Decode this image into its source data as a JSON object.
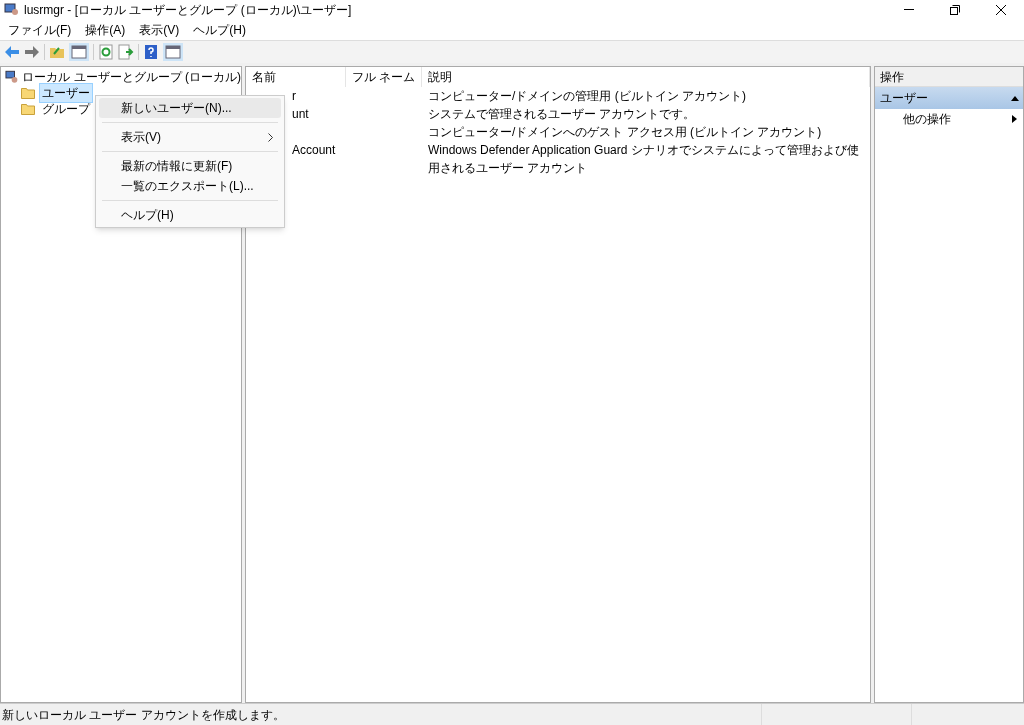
{
  "window": {
    "title": "lusrmgr - [ローカル ユーザーとグループ (ローカル)\\ユーザー]"
  },
  "menu_bar": [
    "ファイル(F)",
    "操作(A)",
    "表示(V)",
    "ヘルプ(H)"
  ],
  "tree": {
    "label": "ローカル ユーザーとグループ (ローカル)",
    "children": [
      {
        "label": "ユーザー",
        "selected": true
      },
      {
        "label": "グループ",
        "selected": false
      }
    ]
  },
  "list": {
    "columns": [
      "名前",
      "フル ネーム",
      "説明"
    ],
    "rows": [
      {
        "name": "r",
        "full_name": "",
        "description": "コンピューター/ドメインの管理用 (ビルトイン アカウント)"
      },
      {
        "name": "unt",
        "full_name": "",
        "description": "システムで管理されるユーザー アカウントです。"
      },
      {
        "name": "",
        "full_name": "",
        "description": "コンピューター/ドメインへのゲスト アクセス用 (ビルトイン アカウント)"
      },
      {
        "name": "Account",
        "full_name": "",
        "description": "Windows Defender Application Guard シナリオでシステムによって管理および使用されるユーザー アカウント"
      }
    ]
  },
  "context_menu": [
    {
      "kind": "item",
      "label": "新しいユーザー(N)...",
      "selected": true,
      "submenu": false
    },
    {
      "kind": "separator"
    },
    {
      "kind": "item",
      "label": "表示(V)",
      "selected": false,
      "submenu": true
    },
    {
      "kind": "separator"
    },
    {
      "kind": "item",
      "label": "最新の情報に更新(F)",
      "selected": false,
      "submenu": false
    },
    {
      "kind": "item",
      "label": "一覧のエクスポート(L)...",
      "selected": false,
      "submenu": false
    },
    {
      "kind": "separator"
    },
    {
      "kind": "item",
      "label": "ヘルプ(H)",
      "selected": false,
      "submenu": false
    }
  ],
  "actions": {
    "header": "操作",
    "section": "ユーザー",
    "items": [
      "他の操作"
    ]
  },
  "status_bar": "新しいローカル ユーザー アカウントを作成します。"
}
